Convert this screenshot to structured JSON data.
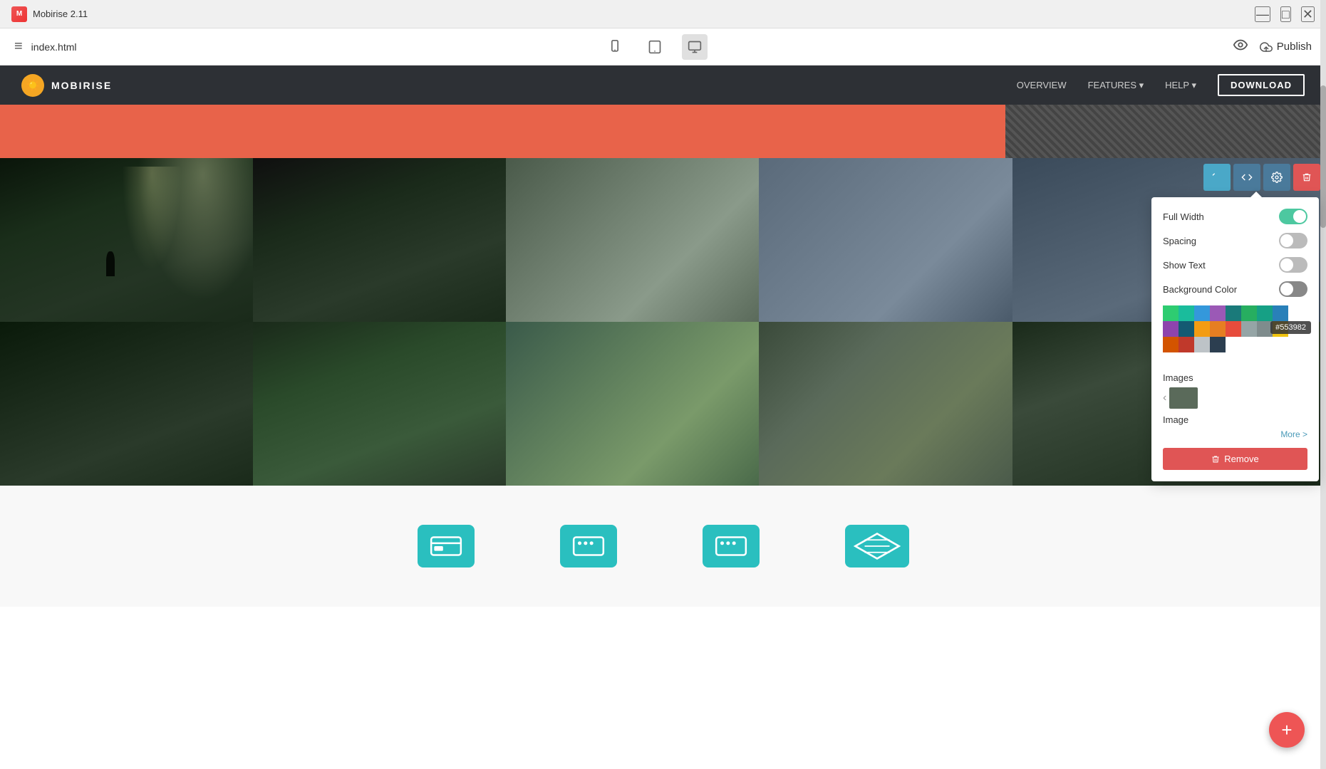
{
  "titleBar": {
    "logo": "M",
    "title": "Mobirise 2.11",
    "minBtn": "—",
    "maxBtn": "□",
    "closeBtn": "✕"
  },
  "toolbar": {
    "menuIcon": "≡",
    "filename": "index.html",
    "deviceBtns": [
      {
        "name": "mobile",
        "icon": "📱",
        "active": false
      },
      {
        "name": "tablet",
        "icon": "⬜",
        "active": false
      },
      {
        "name": "desktop",
        "icon": "🖥",
        "active": true
      }
    ],
    "previewIcon": "👁",
    "publishLabel": "Publish",
    "publishIcon": "☁"
  },
  "navBar": {
    "brandName": "MOBIRISE",
    "links": [
      {
        "label": "OVERVIEW",
        "active": false
      },
      {
        "label": "FEATURES ▾",
        "active": false
      },
      {
        "label": "HELP ▾",
        "active": false
      }
    ],
    "downloadBtn": "DOWNLOAD"
  },
  "settingsPanel": {
    "fullWidthLabel": "Full Width",
    "fullWidthOn": true,
    "spacingLabel": "Spacing",
    "spacingOn": false,
    "showTextLabel": "Show Text",
    "showTextOn": false,
    "backgroundColorLabel": "Background Color",
    "imagesLabel": "Images",
    "imageLabel": "Image",
    "moreLabel": "More >",
    "colorHex": "#553982",
    "removeLabel": "Remove"
  },
  "palette": {
    "colors": [
      "#2ecc71",
      "#1abc9c",
      "#3498db",
      "#9b59b6",
      "#1a7a7a",
      "#27ae60",
      "#16a085",
      "#2980b9",
      "#8e44ad",
      "#145a72",
      "#f39c12",
      "#e67e22",
      "#e74c3c",
      "#95a5a6",
      "#7f8c8d",
      "#f1c40f",
      "#d35400",
      "#c0392b",
      "#bdc3c7",
      "#2c3e50"
    ]
  },
  "fab": {
    "icon": "+"
  }
}
